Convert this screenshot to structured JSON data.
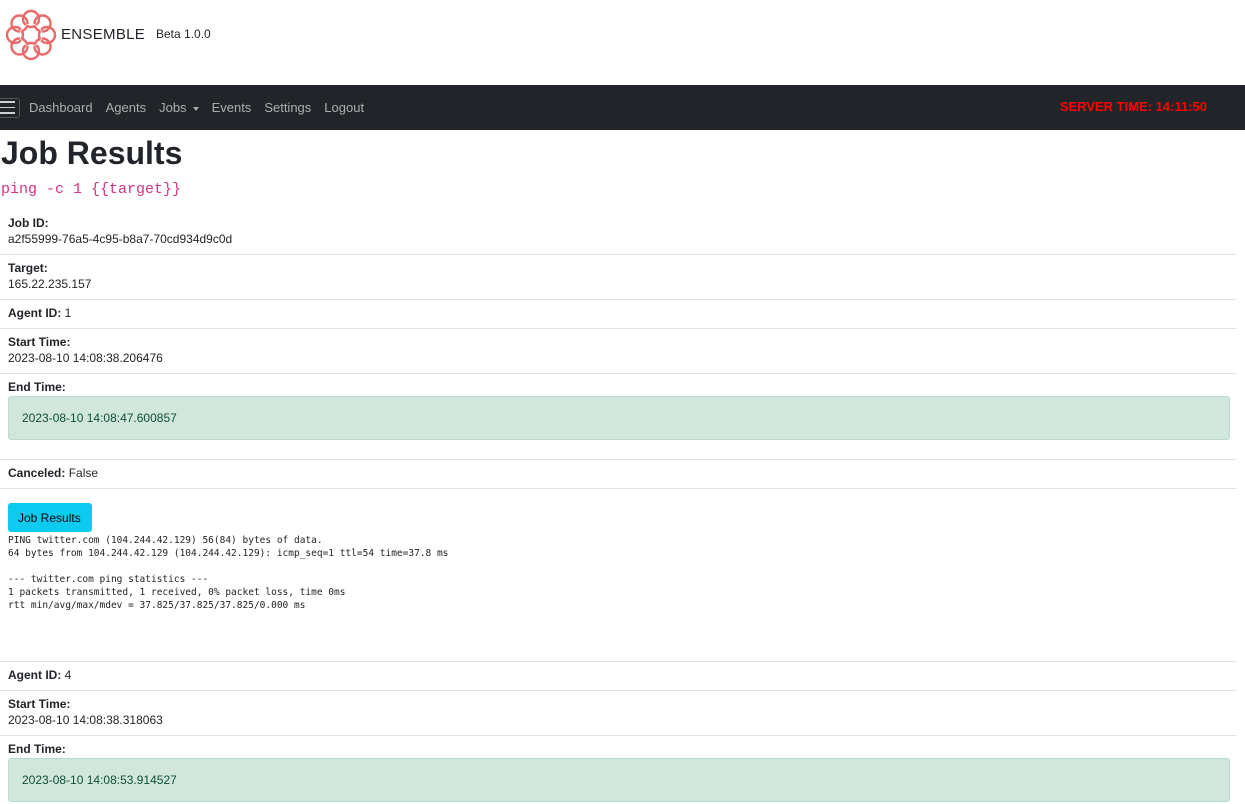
{
  "brand": {
    "name": "ENSEMBLE",
    "version": "Beta 1.0.0",
    "logo_icon": "knot-logo-icon",
    "logo_color": "#e86a6a"
  },
  "nav": {
    "menu_icon": "hamburger-icon",
    "items": [
      "Dashboard",
      "Agents",
      "Jobs",
      "Events",
      "Settings",
      "Logout"
    ],
    "server_time": "SERVER TIME: 14:11:50"
  },
  "page": {
    "title": "Job Results",
    "command": "ping -c 1 {{target}}"
  },
  "job": {
    "id_label": "Job ID:",
    "id_value": "a2f55999-76a5-4c95-b8a7-70cd934d9c0d",
    "target_label": "Target:",
    "target_value": "165.22.235.157"
  },
  "results": [
    {
      "agent_label": "Agent ID:",
      "agent_value": "1",
      "start_label": "Start Time:",
      "start_value": "2023-08-10 14:08:38.206476",
      "end_label": "End Time:",
      "end_value": "2023-08-10 14:08:47.600857",
      "canceled_label": "Canceled:",
      "canceled_value": "False",
      "button_label": "Job Results",
      "output": "PING twitter.com (104.244.42.129) 56(84) bytes of data.\n64 bytes from 104.244.42.129 (104.244.42.129): icmp_seq=1 ttl=54 time=37.8 ms\n\n--- twitter.com ping statistics ---\n1 packets transmitted, 1 received, 0% packet loss, time 0ms\nrtt min/avg/max/mdev = 37.825/37.825/37.825/0.000 ms"
    },
    {
      "agent_label": "Agent ID:",
      "agent_value": "4",
      "start_label": "Start Time:",
      "start_value": "2023-08-10 14:08:38.318063",
      "end_label": "End Time:",
      "end_value": "2023-08-10 14:08:53.914527"
    }
  ]
}
